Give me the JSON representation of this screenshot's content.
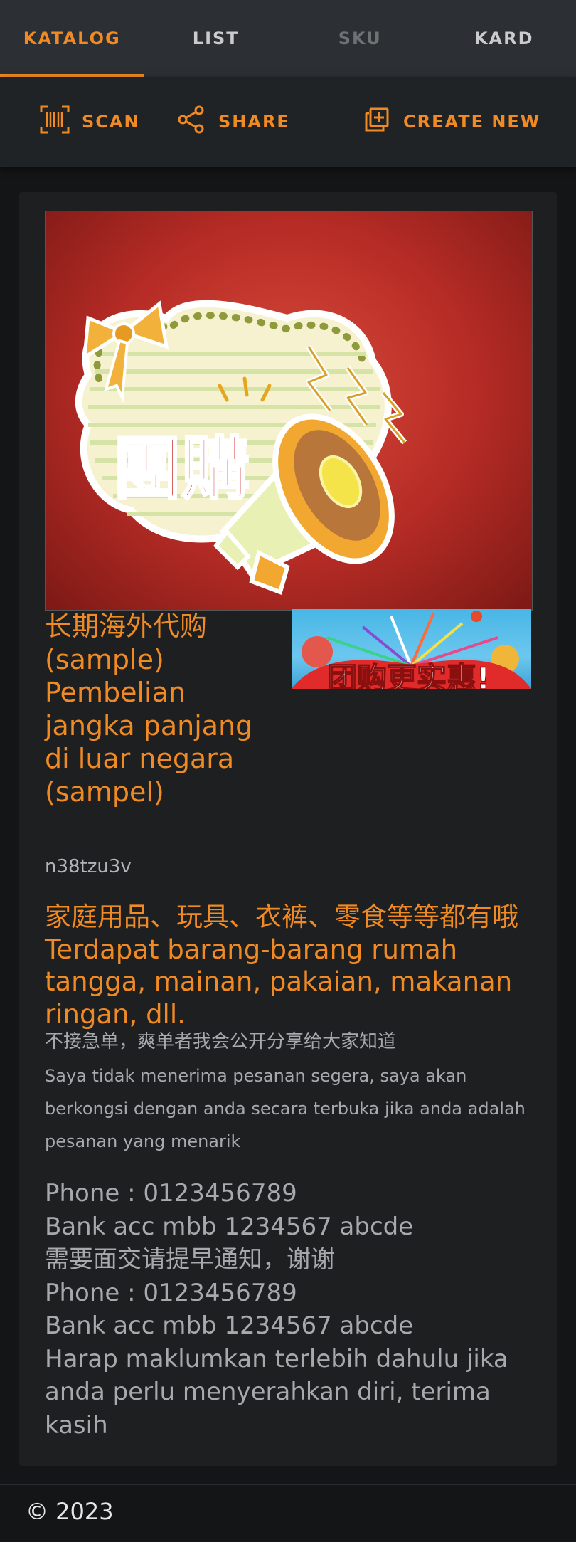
{
  "tabs": [
    {
      "label": "KATALOG",
      "state": "active"
    },
    {
      "label": "LIST",
      "state": "normal"
    },
    {
      "label": "SKU",
      "state": "disabled"
    },
    {
      "label": "KARD",
      "state": "normal"
    }
  ],
  "toolbar": {
    "scan_label": "SCAN",
    "share_label": "SHARE",
    "create_label": "CREATE NEW",
    "scan_icon": "barcode-scan-icon",
    "share_icon": "share-icon",
    "create_icon": "add-box-icon"
  },
  "product": {
    "main_image_text": "團購",
    "thumb_image_text": "团购更实惠!",
    "title": "长期海外代购(sample) Pembelian jangka panjang di luar negara (sampel)",
    "code": "n38tzu3v",
    "description": "家庭用品、玩具、衣裤、零食等等都有哦 Terdapat barang-barang rumah tangga, mainan, pakaian, makanan ringan, dll.",
    "note_zh": "不接急单，爽单者我会公开分享给大家知道",
    "note_ms": "Saya tidak menerima pesanan segera, saya akan berkongsi dengan anda secara terbuka jika anda adalah pesanan yang menarik",
    "contact_lines": [
      "Phone : 0123456789",
      "Bank acc mbb 1234567 abcde",
      "需要面交请提早通知，谢谢",
      "Phone : 0123456789",
      "Bank acc mbb 1234567 abcde",
      "Harap maklumkan terlebih dahulu jika anda perlu menyerahkan diri, terima kasih"
    ]
  },
  "footer": {
    "copyright": "© 2023"
  },
  "colors": {
    "accent": "#f08a24",
    "tabbar": "#2c3034",
    "toolbar": "#202325",
    "card": "#1d1f21",
    "page": "#141516"
  }
}
